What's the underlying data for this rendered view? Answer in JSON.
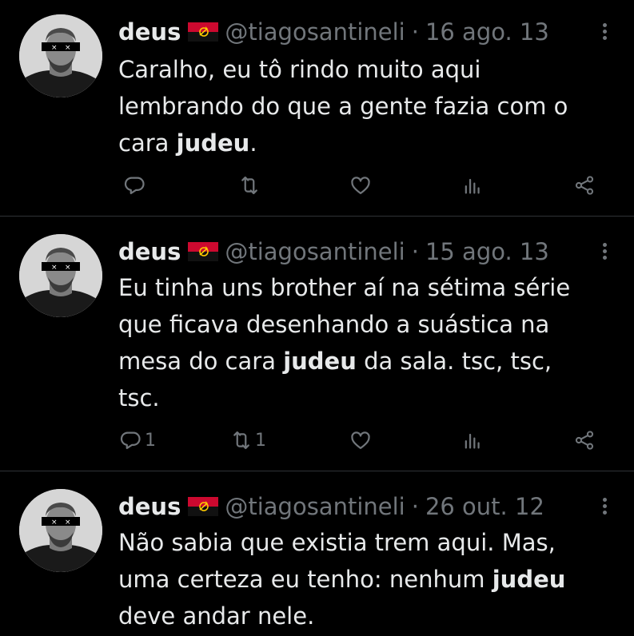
{
  "tweets": [
    {
      "author_name": "deus",
      "handle": "@tiagosantineli",
      "separator": "·",
      "date": "16 ago. 13",
      "text_before": "Caralho, eu tô rindo muito aqui lembrando do que a gente fazia com o cara ",
      "text_bold": "judeu",
      "text_after": ".",
      "reply_count": "",
      "retweet_count": ""
    },
    {
      "author_name": "deus",
      "handle": "@tiagosantineli",
      "separator": "·",
      "date": "15 ago. 13",
      "text_before": "Eu tinha uns brother aí na sétima série que ficava desenhando a suástica na mesa do cara ",
      "text_bold": "judeu",
      "text_after": " da sala. tsc, tsc, tsc.",
      "reply_count": "1",
      "retweet_count": "1"
    },
    {
      "author_name": "deus",
      "handle": "@tiagosantineli",
      "separator": "·",
      "date": "26 out. 12",
      "text_before": "Não sabia que existia trem aqui. Mas, uma certeza eu tenho: nenhum ",
      "text_bold": "judeu",
      "text_after": " deve andar nele.",
      "reply_count": "",
      "retweet_count": ""
    }
  ],
  "icons": {
    "reply": "reply-icon",
    "retweet": "retweet-icon",
    "like": "like-icon",
    "views": "views-icon",
    "share": "share-icon",
    "more": "more-icon",
    "flag": "angola-flag-icon"
  },
  "colors": {
    "background": "#000000",
    "text": "#e7e9ea",
    "muted": "#71767b",
    "divider": "#2f3336",
    "flag_red": "#cc092f",
    "flag_black": "#000000",
    "flag_yellow": "#ffcb00"
  }
}
